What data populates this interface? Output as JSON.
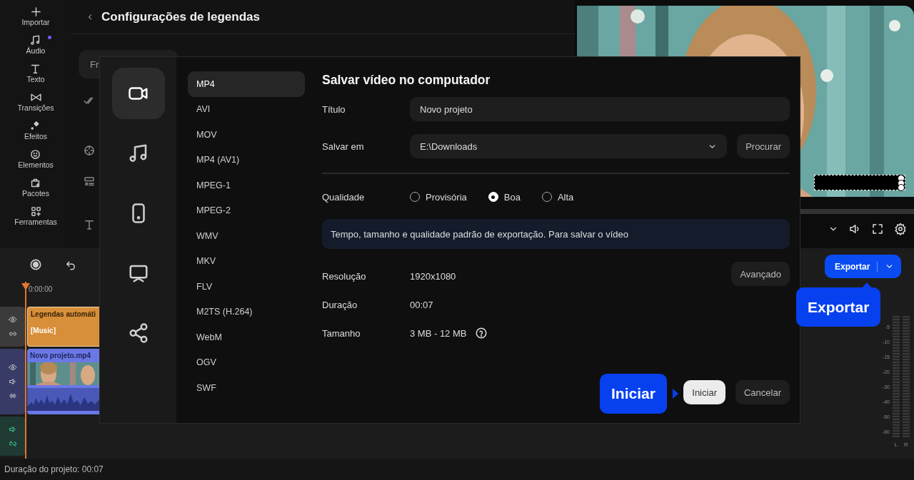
{
  "toolbar": [
    {
      "label": "Importar",
      "dot": false
    },
    {
      "label": "Áudio",
      "dot": true
    },
    {
      "label": "Texto",
      "dot": false
    },
    {
      "label": "Transições",
      "dot": false
    },
    {
      "label": "Efeitos",
      "dot": false
    },
    {
      "label": "Elementos",
      "dot": false
    },
    {
      "label": "Pacotes",
      "dot": false
    },
    {
      "label": "Ferramentas",
      "dot": false
    }
  ],
  "panel": {
    "title": "Configurações de legendas",
    "chip": "Fr"
  },
  "timeline": {
    "ruler": "0:00:00",
    "tracks": [
      {
        "kind": "subtitle",
        "title": "Legendas automáti",
        "text": "[Music]"
      },
      {
        "kind": "video",
        "title": "Novo projeto.mp4"
      },
      {
        "kind": "audio"
      }
    ]
  },
  "export_button": "Exportar",
  "meter": {
    "scale": [
      "-5",
      "-10",
      "-15",
      "-20",
      "-30",
      "-40",
      "-50",
      "-60"
    ],
    "channels": [
      "L",
      "R"
    ]
  },
  "status_bar": "Duração do projeto: 00:07",
  "dialog": {
    "categories": [
      {
        "kind": "video",
        "selected": true
      },
      {
        "kind": "audio",
        "selected": false
      },
      {
        "kind": "phone",
        "selected": false
      },
      {
        "kind": "tv",
        "selected": false
      },
      {
        "kind": "share",
        "selected": false
      }
    ],
    "formats": [
      {
        "label": "MP4",
        "selected": true
      },
      {
        "label": "AVI",
        "selected": false
      },
      {
        "label": "MOV",
        "selected": false
      },
      {
        "label": "MP4 (AV1)",
        "selected": false
      },
      {
        "label": "MPEG-1",
        "selected": false
      },
      {
        "label": "MPEG-2",
        "selected": false
      },
      {
        "label": "WMV",
        "selected": false
      },
      {
        "label": "MKV",
        "selected": false
      },
      {
        "label": "FLV",
        "selected": false
      },
      {
        "label": "M2TS (H.264)",
        "selected": false
      },
      {
        "label": "WebM",
        "selected": false
      },
      {
        "label": "OGV",
        "selected": false
      },
      {
        "label": "SWF",
        "selected": false
      }
    ],
    "title": "Salvar vídeo no computador",
    "title_field": {
      "label": "Título",
      "value": "Novo projeto"
    },
    "folder_field": {
      "label": "Salvar em",
      "value": "E:\\Downloads",
      "browse": "Procurar"
    },
    "quality": {
      "label": "Qualidade",
      "options": [
        {
          "label": "Provisória",
          "selected": false
        },
        {
          "label": "Boa",
          "selected": true
        },
        {
          "label": "Alta",
          "selected": false
        }
      ]
    },
    "info": "Tempo, tamanho e qualidade padrão de exportação. Para salvar o vídeo",
    "details": [
      {
        "label": "Resolução",
        "value": "1920x1080",
        "help": false
      },
      {
        "label": "Duração",
        "value": "00:07",
        "help": false
      },
      {
        "label": "Tamanho",
        "value": "3 MB - 12 MB",
        "help": true
      }
    ],
    "advanced": "Avançado",
    "start": "Iniciar",
    "cancel": "Cancelar"
  },
  "callouts": [
    {
      "text": "Exportar"
    },
    {
      "text": "Iniciar"
    }
  ]
}
